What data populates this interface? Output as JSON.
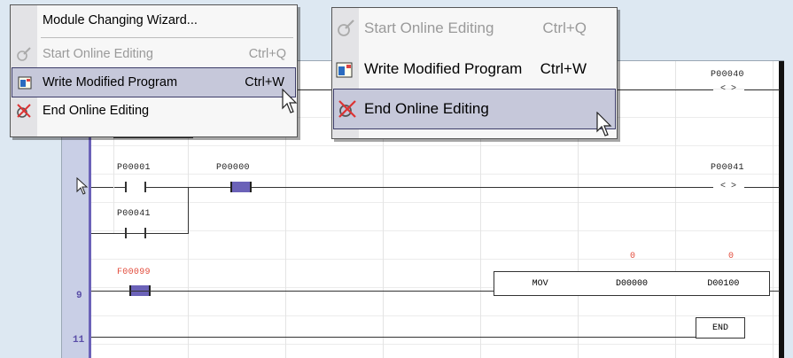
{
  "menu_left": {
    "items": [
      {
        "label": "Module Changing Wizard...",
        "shortcut": "",
        "icon": "none",
        "disabled": false,
        "highlighted": false
      },
      {
        "label": "Start Online Editing",
        "shortcut": "Ctrl+Q",
        "icon": "start-online-edit-icon",
        "disabled": true,
        "highlighted": false
      },
      {
        "label": "Write Modified Program",
        "shortcut": "Ctrl+W",
        "icon": "write-program-icon",
        "disabled": false,
        "highlighted": true
      },
      {
        "label": "End Online Editing",
        "shortcut": "",
        "icon": "end-online-edit-icon",
        "disabled": false,
        "highlighted": false
      }
    ]
  },
  "menu_right": {
    "items": [
      {
        "label": "Start Online Editing",
        "shortcut": "Ctrl+Q",
        "icon": "start-online-edit-icon",
        "disabled": true,
        "highlighted": false
      },
      {
        "label": "Write Modified Program",
        "shortcut": "Ctrl+W",
        "icon": "write-program-icon",
        "disabled": false,
        "highlighted": false
      },
      {
        "label": "End Online Editing",
        "shortcut": "",
        "icon": "end-online-edit-icon",
        "disabled": false,
        "highlighted": true
      }
    ]
  },
  "ladder": {
    "coil_top_label": "P00040",
    "coil_symbol": "< >",
    "contact_a": "P00001",
    "contact_b": "P00000",
    "contact_c": "P00041",
    "coil_mid_label": "P00041",
    "flag_label": "F00099",
    "mov": {
      "op": "MOV",
      "src": "D00000",
      "dst": "D00100",
      "src_val": "0",
      "dst_val": "0"
    },
    "end_label": "END",
    "row_numbers": [
      "9",
      "11"
    ]
  },
  "colors": {
    "accent": "#6b62b8",
    "highlight": "#c6c8da",
    "red": "#e24b3b"
  }
}
